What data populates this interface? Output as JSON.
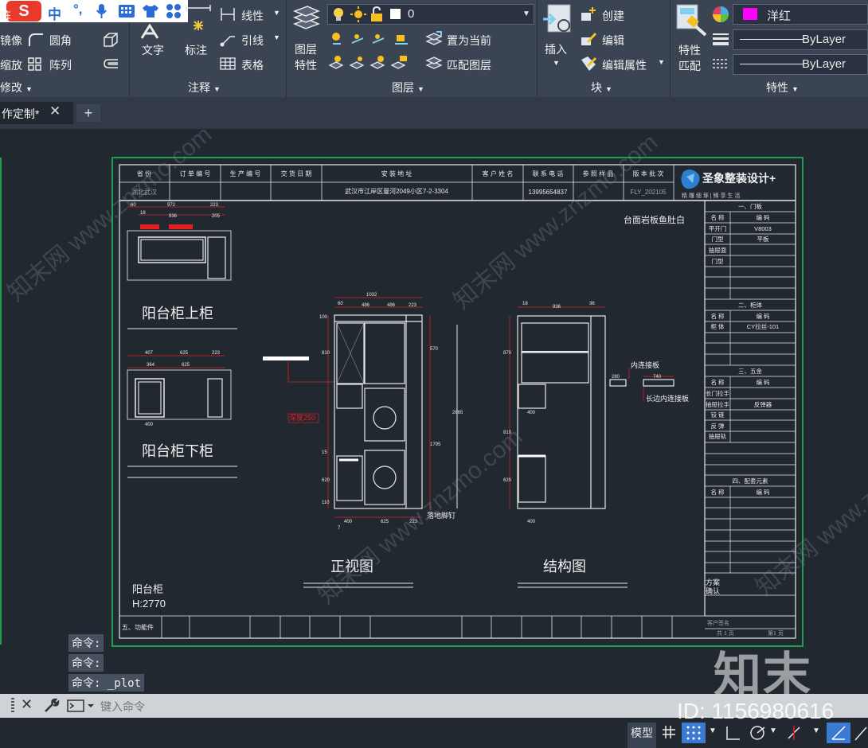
{
  "ime_toolbar": {
    "logo": "S",
    "lang": "中",
    "punct": "°,"
  },
  "ribbon": {
    "modify": {
      "mirror": "镜像",
      "fillet": "圆角",
      "scale": "缩放",
      "array": "阵列",
      "panel": "修改",
      "cut_text": "阵"
    },
    "annotation": {
      "text": "文字",
      "dimension": "标注",
      "linear": "线性",
      "leader": "引线",
      "table": "表格",
      "panel": "注释"
    },
    "layers": {
      "layer_props_1": "图层",
      "layer_props_2": "特性",
      "current_layer": "0",
      "set_current": "置为当前",
      "match_layer": "匹配图层",
      "panel": "图层"
    },
    "block": {
      "insert": "插入",
      "create": "创建",
      "edit": "编辑",
      "edit_attr": "编辑属性",
      "panel": "块"
    },
    "properties": {
      "match_1": "特性",
      "match_2": "匹配",
      "color": "洋红",
      "color_hex": "#ff00ff",
      "linetype": "ByLayer",
      "lineweight": "ByLayer",
      "panel": "特性"
    }
  },
  "tabs": {
    "current": "作定制*"
  },
  "drawing": {
    "title_block": {
      "headers": [
        "省 份",
        "订 单 编 号",
        "生 产 编 号",
        "交 货 日 期",
        "安 装 地 址",
        "客 户 姓 名",
        "联 系 电 话",
        "参 照 样 品",
        "版 本 批 次"
      ],
      "values": [
        "湖北武汉",
        "",
        "",
        "",
        "武汉市江岸区曼河2049小区7-2-3304",
        "",
        "13995654837",
        "",
        "FLY_202105"
      ],
      "company": "圣象整装设计+",
      "company_sub": "精 雕 细 琢  |  臻 享 生 活"
    },
    "note_top": "台面岩板鱼肚白",
    "views": {
      "upper_label": "阳台柜上柜",
      "lower_label": "阳台柜下柜",
      "front_label": "正视图",
      "struct_label": "结构图",
      "cabinet_name": "阳台柜",
      "cabinet_height": "H:2770"
    },
    "upper_dims": [
      "60",
      "972",
      "223",
      "18",
      "936",
      "205"
    ],
    "lower_dims": [
      "407",
      "625",
      "223",
      "364",
      "625",
      "400"
    ],
    "front_dims": [
      "1032",
      "60",
      "486",
      "486",
      "223",
      "100",
      "810",
      "570",
      "2665",
      "1795",
      "15",
      "620",
      "110",
      "400",
      "625",
      "7",
      "223"
    ],
    "struct_dims": [
      "18",
      "936",
      "36",
      "870",
      "400",
      "280",
      "740",
      "810",
      "620",
      "400"
    ],
    "annotations": {
      "depth": "深度250",
      "floor_nail": "落地脚钉",
      "inner_plate": "内连接板",
      "long_plate": "长边内连接板"
    },
    "spec_table": {
      "sec1": "一、门板",
      "sec2": "二、柜体",
      "sec3": "三、五金",
      "sec4": "四、配套元素",
      "col_name": "名  称",
      "col_code": "编    码",
      "r1": [
        "平开门",
        "V8003"
      ],
      "r2": [
        "门型",
        "平板"
      ],
      "r3": [
        "抽屉面",
        ""
      ],
      "r4": [
        "门型",
        ""
      ],
      "r5": [
        "柜 体",
        "CY拉丝-101"
      ],
      "r6": [
        "长门拉手",
        ""
      ],
      "r7": [
        "抽屉拉手",
        "反弹器"
      ],
      "r8": [
        "铰 链",
        ""
      ],
      "r9": [
        "反 弹",
        ""
      ],
      "r10": [
        "抽屉轨",
        ""
      ],
      "footer_1": "方案",
      "footer_2": "确认",
      "footer_3": "客户签名",
      "page_1": "共 1 页",
      "page_2": "第1 页"
    },
    "bottom_row": "五、功能件"
  },
  "watermark": {
    "text1": "知末网 www.znzmo.com",
    "brand": "知末",
    "id": "ID: 1156980616"
  },
  "command": {
    "line1": "命令:",
    "line2": "命令:",
    "line3": "命令: _plot",
    "placeholder": "键入命令"
  },
  "status": {
    "model": "模型"
  }
}
